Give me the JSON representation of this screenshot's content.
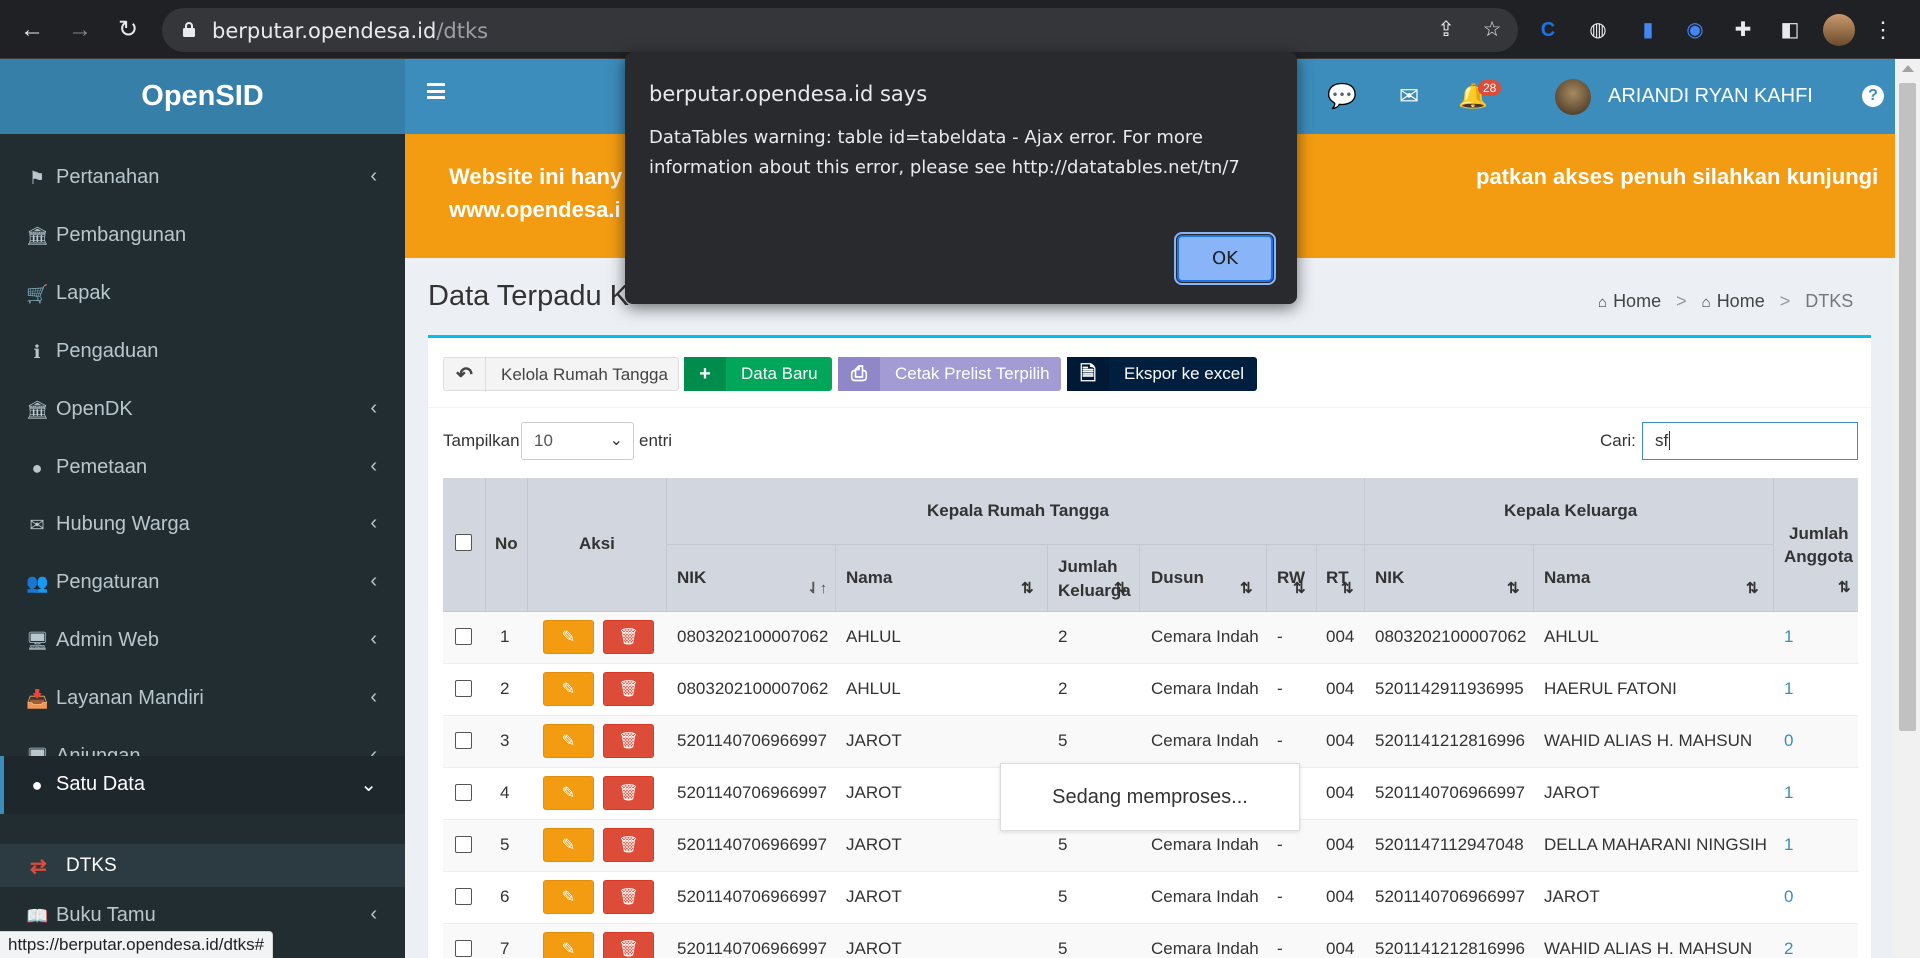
{
  "browser": {
    "url_domain": "berputar.opendesa.id",
    "url_path": "/dtks",
    "status_url": "https://berputar.opendesa.id/dtks#"
  },
  "sidebar": {
    "brand": "OpenSID",
    "items": [
      {
        "label": "Pertanahan",
        "icon": "map-sign-icon",
        "glyph": "⚑",
        "chevron": true
      },
      {
        "label": "Pembangunan",
        "icon": "bank-icon",
        "glyph": "🏛",
        "chevron": false
      },
      {
        "label": "Lapak",
        "icon": "cart-icon",
        "glyph": "🛒",
        "chevron": false
      },
      {
        "label": "Pengaduan",
        "icon": "info-icon",
        "glyph": "ℹ",
        "chevron": false
      },
      {
        "label": "OpenDK",
        "icon": "bank-icon",
        "glyph": "🏛",
        "chevron": true
      },
      {
        "label": "Pemetaan",
        "icon": "globe-icon",
        "glyph": "●",
        "chevron": true
      },
      {
        "label": "Hubung Warga",
        "icon": "envelope-icon",
        "glyph": "✉",
        "chevron": true
      },
      {
        "label": "Pengaturan",
        "icon": "users-icon",
        "glyph": "👥",
        "chevron": true
      },
      {
        "label": "Admin Web",
        "icon": "desktop-icon",
        "glyph": "🖥",
        "chevron": true
      },
      {
        "label": "Layanan Mandiri",
        "icon": "inbox-icon",
        "glyph": "📥",
        "chevron": true
      },
      {
        "label": "Anjungan",
        "icon": "desktop-icon",
        "glyph": "🖥",
        "chevron": true
      },
      {
        "label": "Satu Data",
        "icon": "globe-icon",
        "glyph": "●",
        "chevron": true,
        "active": true
      },
      {
        "label": "Buku Tamu",
        "icon": "book-icon",
        "glyph": "📖",
        "chevron": true
      }
    ],
    "submenu": {
      "label": "DTKS",
      "icon": "exchange-icon"
    }
  },
  "topbar": {
    "notification_count": "28",
    "user_name": "ARIANDI RYAN KAHFI"
  },
  "banner": {
    "line1_left": "Website ini hany",
    "line1_right": "patkan akses penuh silahkan kunjungi",
    "line2": "www.opendesa.i"
  },
  "page": {
    "title": "Data Terpadu K",
    "breadcrumb": [
      "Home",
      "Home",
      "DTKS"
    ]
  },
  "toolbar": {
    "kelola_label": "Kelola Rumah Tangga",
    "baru_label": "Data Baru",
    "cetak_label": "Cetak Prelist Terpilih",
    "ekspor_label": "Ekspor ke excel"
  },
  "table_controls": {
    "show_label": "Tampilkan",
    "page_length": "10",
    "entries_label": "entri",
    "search_label": "Cari:",
    "search_value": "sf"
  },
  "table": {
    "group_headers": {
      "kepala_rumah_tangga": "Kepala Rumah Tangga",
      "kepala_keluarga": "Kepala Keluarga"
    },
    "headers": {
      "no": "No",
      "aksi": "Aksi",
      "nik": "NIK",
      "nama": "Nama",
      "jumlah_keluarga_1": "Jumlah",
      "jumlah_keluarga_2": "Keluarga",
      "dusun": "Dusun",
      "rw": "RW",
      "rt": "RT",
      "kk_nik": "NIK",
      "kk_nama": "Nama",
      "jumlah_anggota_1": "Jumlah",
      "jumlah_anggota_2": "Anggota"
    },
    "rows": [
      {
        "no": "1",
        "nik": "0803202100007062",
        "nama": "AHLUL",
        "jumlah_keluarga": "2",
        "dusun": "Cemara Indah",
        "rw": "-",
        "rt": "004",
        "kk_nik": "0803202100007062",
        "kk_nama": "AHLUL",
        "jumlah_anggota": "1"
      },
      {
        "no": "2",
        "nik": "0803202100007062",
        "nama": "AHLUL",
        "jumlah_keluarga": "2",
        "dusun": "Cemara Indah",
        "rw": "-",
        "rt": "004",
        "kk_nik": "5201142911936995",
        "kk_nama": "HAERUL FATONI",
        "jumlah_anggota": "1"
      },
      {
        "no": "3",
        "nik": "5201140706966997",
        "nama": "JAROT",
        "jumlah_keluarga": "5",
        "dusun": "Cemara Indah",
        "rw": "-",
        "rt": "004",
        "kk_nik": "5201141212816996",
        "kk_nama": "WAHID ALIAS H. MAHSUN",
        "jumlah_anggota": "0"
      },
      {
        "no": "4",
        "nik": "5201140706966997",
        "nama": "JAROT",
        "jumlah_keluarga": "",
        "dusun": "",
        "rw": "",
        "rt": "004",
        "kk_nik": "5201140706966997",
        "kk_nama": "JAROT",
        "jumlah_anggota": "1"
      },
      {
        "no": "5",
        "nik": "5201140706966997",
        "nama": "JAROT",
        "jumlah_keluarga": "5",
        "dusun": "Cemara Indah",
        "rw": "-",
        "rt": "004",
        "kk_nik": "5201147112947048",
        "kk_nama": "DELLA MAHARANI NINGSIH",
        "jumlah_anggota": "1"
      },
      {
        "no": "6",
        "nik": "5201140706966997",
        "nama": "JAROT",
        "jumlah_keluarga": "5",
        "dusun": "Cemara Indah",
        "rw": "-",
        "rt": "004",
        "kk_nik": "5201140706966997",
        "kk_nama": "JAROT",
        "jumlah_anggota": "0"
      },
      {
        "no": "7",
        "nik": "5201140706966997",
        "nama": "JAROT",
        "jumlah_keluarga": "5",
        "dusun": "Cemara Indah",
        "rw": "-",
        "rt": "004",
        "kk_nik": "5201141212816996",
        "kk_nama": "WAHID ALIAS H. MAHSUN",
        "jumlah_anggota": "2"
      }
    ]
  },
  "processing_text": "Sedang memproses...",
  "dialog": {
    "title": "berputar.opendesa.id says",
    "message": "DataTables warning: table id=tabeldata - Ajax error. For more information about this error, please see http://datatables.net/tn/7",
    "ok_label": "OK"
  },
  "colors": {
    "brand_blue": "#3c8dbc",
    "sidebar_dark": "#222d32",
    "banner_orange": "#f39c12",
    "success": "#00a65a",
    "danger": "#dd4b39"
  }
}
